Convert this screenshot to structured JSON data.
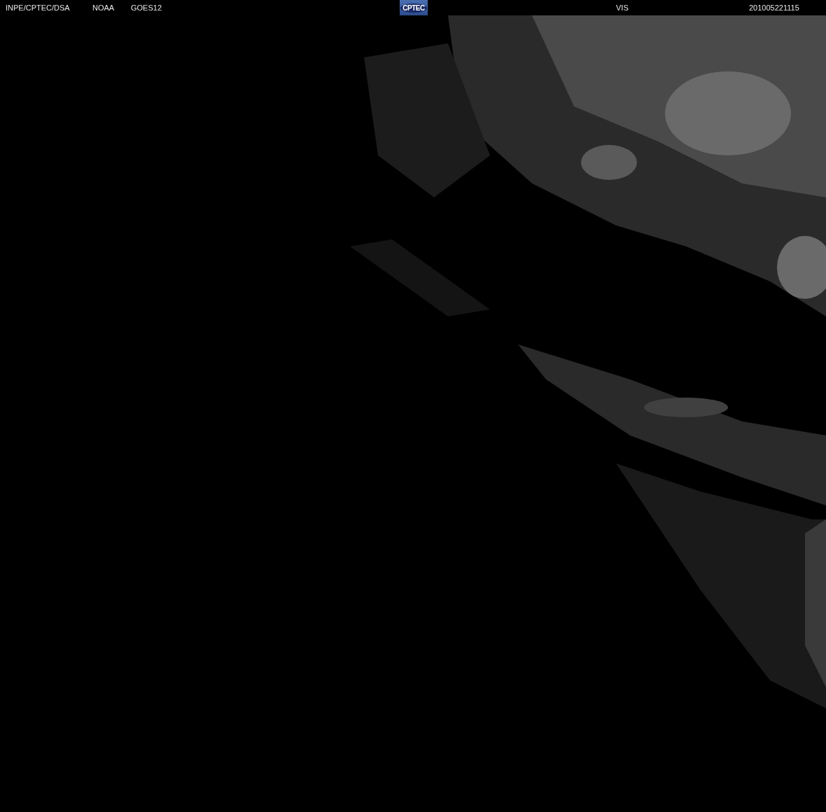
{
  "header": {
    "labels": [
      "INPE/CPTEC/DSA",
      "NOAA",
      "GOES12"
    ],
    "logo": "CPTEC",
    "channel": "VIS",
    "timestamp": "201005221115"
  }
}
